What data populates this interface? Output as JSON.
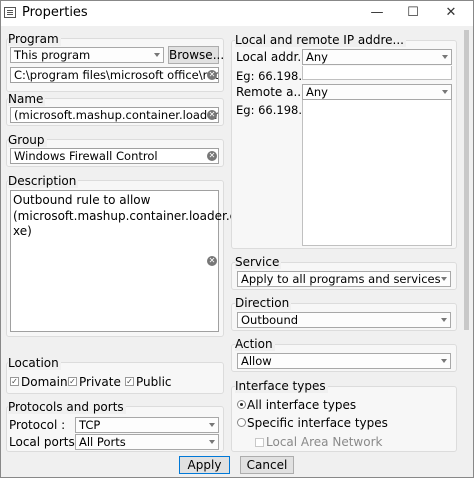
{
  "window": {
    "title": "Properties",
    "min_glyph": "—",
    "max_glyph": "☐",
    "close_glyph": "✕"
  },
  "program": {
    "label": "Program",
    "select_value": "This program",
    "browse_label": "Browse...",
    "path_value": "C:\\program files\\microsoft office\\root\\"
  },
  "name": {
    "label": "Name",
    "value": "(microsoft.mashup.container.loader.ex"
  },
  "group": {
    "label": "Group",
    "value": "Windows Firewall Control"
  },
  "description": {
    "label": "Description",
    "value": "Outbound rule to allow\n(microsoft.mashup.container.loader.e\nxe)"
  },
  "location": {
    "label": "Location",
    "domain": "Domain",
    "private": "Private",
    "public": "Public"
  },
  "protocols": {
    "label": "Protocols and ports",
    "protocol_label": "Protocol :",
    "protocol_value": "TCP",
    "local_ports_label": "Local ports :",
    "local_ports_value": "All Ports"
  },
  "ip": {
    "label": "Local and remote IP addre...",
    "local_label": "Local addr...",
    "local_value": "Any",
    "local_example": "Eg: 66.198....",
    "remote_label": "Remote a...",
    "remote_value": "Any",
    "remote_example": "Eg: 66.198...."
  },
  "service": {
    "label": "Service",
    "value": "Apply to all programs and services"
  },
  "direction": {
    "label": "Direction",
    "value": "Outbound"
  },
  "action": {
    "label": "Action",
    "value": "Allow"
  },
  "interface": {
    "label": "Interface types",
    "all": "All interface types",
    "specific": "Specific interface types",
    "lan": "Local Area Network"
  },
  "footer": {
    "apply": "Apply",
    "cancel": "Cancel"
  }
}
